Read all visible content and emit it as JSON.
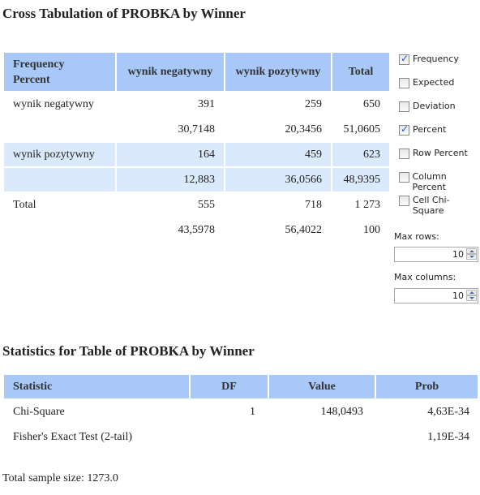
{
  "crosstab": {
    "title": "Cross Tabulation of PROBKA by Winner",
    "header": {
      "corner_line1": "Frequency",
      "corner_line2": "Percent",
      "columns": [
        "wynik negatywny",
        "wynik pozytywny",
        "Total"
      ]
    },
    "rows": [
      {
        "label": "wynik negatywny",
        "frequency": [
          "391",
          "259",
          "650"
        ],
        "percent": [
          "30,7148",
          "20,3456",
          "51,0605"
        ]
      },
      {
        "label": "wynik pozytywny",
        "frequency": [
          "164",
          "459",
          "623"
        ],
        "percent": [
          "12,883",
          "36,0566",
          "48,9395"
        ]
      },
      {
        "label": "Total",
        "frequency": [
          "555",
          "718",
          "1 273"
        ],
        "percent": [
          "43,5978",
          "56,4022",
          "100"
        ]
      }
    ]
  },
  "options": {
    "checkboxes": [
      {
        "label": "Frequency",
        "checked": true
      },
      {
        "label": "Expected",
        "checked": false
      },
      {
        "label": "Deviation",
        "checked": false
      },
      {
        "label": "Percent",
        "checked": true
      },
      {
        "label": "Row Percent",
        "checked": false
      },
      {
        "label": "Column Percent",
        "checked": false
      },
      {
        "label": "Cell Chi-Square",
        "checked": false
      }
    ],
    "max_rows_label": "Max rows:",
    "max_rows_value": "10",
    "max_columns_label": "Max columns:",
    "max_columns_value": "10"
  },
  "stats": {
    "title": "Statistics for Table of PROBKA by Winner",
    "columns": [
      "Statistic",
      "DF",
      "Value",
      "Prob"
    ],
    "rows": [
      {
        "statistic": "Chi-Square",
        "df": "1",
        "value": "148,0493",
        "prob": "4,63E-34"
      },
      {
        "statistic": "Fisher's Exact Test (2-tail)",
        "df": "",
        "value": "",
        "prob": "1,19E-34"
      }
    ]
  },
  "footer": {
    "sample_size": "Total sample size: 1273.0"
  }
}
